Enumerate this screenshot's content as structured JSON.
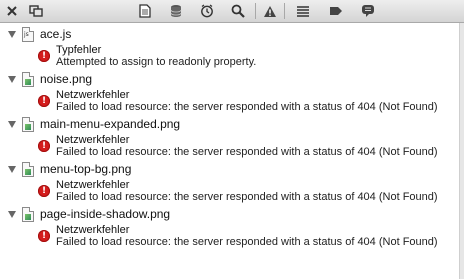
{
  "toolbar": {
    "buttons": [
      {
        "name": "close-icon",
        "glyph": "✕"
      },
      {
        "name": "window-split-icon",
        "glyph": ""
      },
      {
        "name": "document-icon",
        "glyph": ""
      },
      {
        "name": "database-icon",
        "glyph": ""
      },
      {
        "name": "timeline-icon",
        "glyph": ""
      },
      {
        "name": "search-icon",
        "glyph": ""
      },
      {
        "name": "warning-icon",
        "glyph": ""
      },
      {
        "name": "console-icon",
        "glyph": ""
      },
      {
        "name": "tag-icon",
        "glyph": ""
      },
      {
        "name": "speech-bubble-icon",
        "glyph": ""
      }
    ]
  },
  "entries": [
    {
      "file": "ace.js",
      "kind": "script",
      "error_type": "Typfehler",
      "message": "Attempted to assign to readonly property."
    },
    {
      "file": "noise.png",
      "kind": "image",
      "error_type": "Netzwerkfehler",
      "message": "Failed to load resource: the server responded with a status of 404 (Not Found)"
    },
    {
      "file": "main-menu-expanded.png",
      "kind": "image",
      "error_type": "Netzwerkfehler",
      "message": "Failed to load resource: the server responded with a status of 404 (Not Found)"
    },
    {
      "file": "menu-top-bg.png",
      "kind": "image",
      "error_type": "Netzwerkfehler",
      "message": "Failed to load resource: the server responded with a status of 404 (Not Found)"
    },
    {
      "file": "page-inside-shadow.png",
      "kind": "image",
      "error_type": "Netzwerkfehler",
      "message": "Failed to load resource: the server responded with a status of 404 (Not Found)"
    }
  ],
  "colors": {
    "error_red": "#d41c1c",
    "toolbar_top": "#eeeeee",
    "toolbar_bottom": "#d4d4d4"
  }
}
